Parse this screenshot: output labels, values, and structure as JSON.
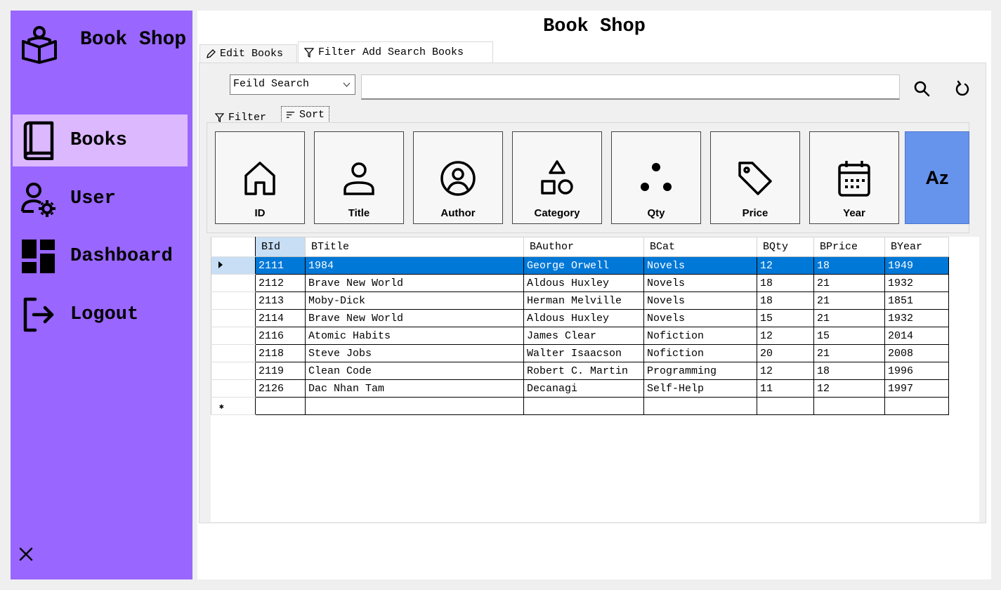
{
  "sidebar": {
    "brand": "Book Shop",
    "items": [
      {
        "label": "Books",
        "icon": "book-icon",
        "active": true
      },
      {
        "label": "User",
        "icon": "user-settings-icon",
        "active": false
      },
      {
        "label": "Dashboard",
        "icon": "dashboard-icon",
        "active": false
      },
      {
        "label": "Logout",
        "icon": "logout-icon",
        "active": false
      }
    ],
    "close_icon": "close-icon",
    "bg_color": "#9966ff",
    "active_color": "#dcb8ff"
  },
  "header": {
    "title": "Book Shop"
  },
  "tabs": [
    {
      "label": "Edit Books",
      "icon": "pencil-icon"
    },
    {
      "label": "Filter Add Search Books",
      "icon": "filter-icon",
      "selected": true
    }
  ],
  "search": {
    "field_select_value": "Feild Search",
    "query": "",
    "search_icon": "search-icon",
    "refresh_icon": "refresh-icon"
  },
  "subtabs": [
    {
      "label": "Filter",
      "icon": "filter-icon"
    },
    {
      "label": "Sort",
      "icon": "sort-lines-icon",
      "selected": true
    }
  ],
  "sort_buttons": [
    {
      "label": "ID",
      "icon": "home-icon"
    },
    {
      "label": "Title",
      "icon": "person-icon"
    },
    {
      "label": "Author",
      "icon": "user-circle-icon"
    },
    {
      "label": "Category",
      "icon": "shapes-icon"
    },
    {
      "label": "Qty",
      "icon": "dots-icon"
    },
    {
      "label": "Price",
      "icon": "tag-icon"
    },
    {
      "label": "Year",
      "icon": "calendar-icon"
    },
    {
      "label": "Az",
      "icon": "az-icon",
      "accent": "#6693ec"
    }
  ],
  "grid": {
    "columns": [
      "BId",
      "BTitle",
      "BAuthor",
      "BCat",
      "BQty",
      "BPrice",
      "BYear"
    ],
    "rows": [
      [
        "2111",
        "1984",
        "George Orwell",
        "Novels",
        "12",
        "18",
        "1949"
      ],
      [
        "2112",
        "Brave New World",
        "Aldous Huxley",
        "Novels",
        "18",
        "21",
        "1932"
      ],
      [
        "2113",
        "Moby-Dick",
        "Herman Melville",
        "Novels",
        "18",
        "21",
        "1851"
      ],
      [
        "2114",
        "Brave New World",
        "Aldous Huxley",
        "Novels",
        "15",
        "21",
        "1932"
      ],
      [
        "2116",
        "Atomic Habits",
        "James Clear",
        "Nofiction",
        "12",
        "15",
        "2014"
      ],
      [
        "2118",
        "Steve Jobs",
        "Walter Isaacson",
        "Nofiction",
        "20",
        "21",
        "2008"
      ],
      [
        "2119",
        "Clean Code",
        "Robert C. Martin",
        "Programming",
        "12",
        "18",
        "1996"
      ],
      [
        "2126",
        "Dac Nhan Tam",
        "Decanagi",
        "Self-Help",
        "11",
        "12",
        "1997"
      ]
    ],
    "selected_row": 0,
    "selection_color": "#0078d7"
  }
}
